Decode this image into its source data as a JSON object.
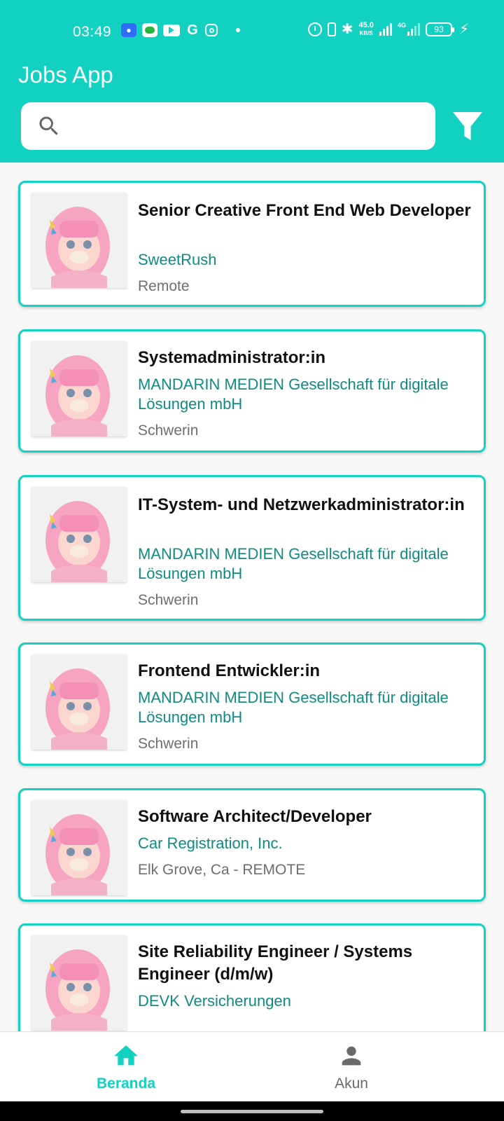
{
  "status_bar": {
    "time": "03:49",
    "network_speed_value": "45.0",
    "network_speed_unit": "KB/S",
    "network_type": "4G",
    "battery_level": "93"
  },
  "app": {
    "title": "Jobs App",
    "accent_color": "#12d1c0"
  },
  "search": {
    "placeholder": "",
    "value": ""
  },
  "jobs": [
    {
      "title": "Senior Creative Front End Web Developer",
      "company": "SweetRush",
      "location": "Remote"
    },
    {
      "title": "Systemadministrator:in",
      "company": "MANDARIN MEDIEN Gesellschaft für digitale Lösungen mbH",
      "location": "Schwerin"
    },
    {
      "title": "IT-System- und Netzwerkadministrator:in",
      "company": "MANDARIN MEDIEN Gesellschaft für digitale Lösungen mbH",
      "location": "Schwerin"
    },
    {
      "title": "Frontend Entwickler:in",
      "company": "MANDARIN MEDIEN Gesellschaft für digitale Lösungen mbH",
      "location": "Schwerin"
    },
    {
      "title": "Software Architect/Developer",
      "company": "Car Registration, Inc.",
      "location": "Elk Grove, Ca - REMOTE"
    },
    {
      "title": "Site Reliability Engineer / Systems Engineer (d/m/w)",
      "company": "DEVK Versicherungen",
      "location": ""
    }
  ],
  "bottom_nav": {
    "items": [
      {
        "label": "Beranda",
        "icon": "home-icon",
        "active": true
      },
      {
        "label": "Akun",
        "icon": "person-icon",
        "active": false
      }
    ]
  }
}
